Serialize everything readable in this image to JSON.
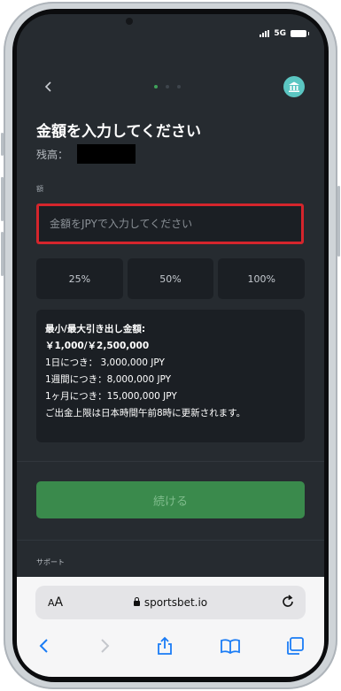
{
  "status_bar": {
    "network": "5G"
  },
  "nav": {
    "back_icon": "chevron-left-icon",
    "home_icon": "bank-icon",
    "steps": 3,
    "active_step": 1
  },
  "header": {
    "title": "金額を入力してください",
    "balance_label": "残高："
  },
  "form": {
    "amount_label": "額",
    "amount_placeholder": "金額をJPYで入力してください",
    "percent_buttons": [
      "25%",
      "50%",
      "100%"
    ]
  },
  "limits": {
    "heading": "最小/最大引き出し金額:",
    "range": "￥1,000/￥2,500,000",
    "daily": "1日につき：  3,000,000 JPY",
    "weekly": "1週間につき：8,000,000 JPY",
    "monthly": "1ヶ月につき：15,000,000 JPY",
    "note": "ご出金上限は日本時間午前8時に更新されます。"
  },
  "continue_label": "続ける",
  "support_label": "サポート",
  "browser": {
    "aa_small": "A",
    "aa_large": "A",
    "url": "sportsbet.io",
    "toolbar_icons": [
      "back-icon",
      "forward-icon",
      "share-icon",
      "bookmarks-icon",
      "tabs-icon"
    ]
  },
  "colors": {
    "accent": "#3a8a4c",
    "highlight": "#d5252c",
    "home": "#5bc6c2"
  }
}
